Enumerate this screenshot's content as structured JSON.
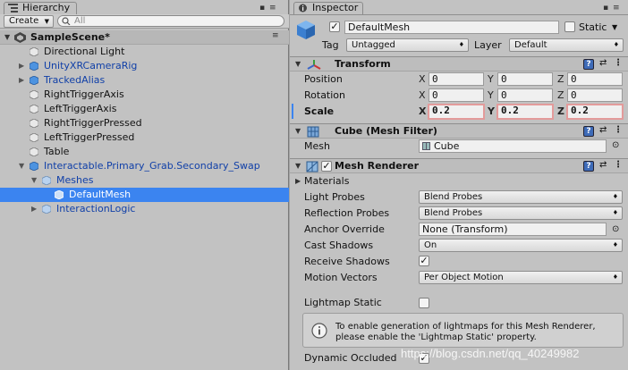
{
  "hierarchy": {
    "tab_label": "Hierarchy",
    "create_label": "Create",
    "search_placeholder": "All",
    "scene_name": "SampleScene*",
    "items": [
      {
        "label": "Directional Light"
      },
      {
        "label": "UnityXRCameraRig"
      },
      {
        "label": "TrackedAlias"
      },
      {
        "label": "RightTriggerAxis"
      },
      {
        "label": "LeftTriggerAxis"
      },
      {
        "label": "RightTriggerPressed"
      },
      {
        "label": "LeftTriggerPressed"
      },
      {
        "label": "Table"
      },
      {
        "label": "Interactable.Primary_Grab.Secondary_Swap"
      },
      {
        "label": "Meshes"
      },
      {
        "label": "DefaultMesh"
      },
      {
        "label": "InteractionLogic"
      }
    ]
  },
  "inspector": {
    "tab_label": "Inspector",
    "object_name": "DefaultMesh",
    "static_label": "Static",
    "tag_label": "Tag",
    "tag_value": "Untagged",
    "layer_label": "Layer",
    "layer_value": "Default",
    "transform": {
      "title": "Transform",
      "position_label": "Position",
      "rotation_label": "Rotation",
      "scale_label": "Scale",
      "axes": [
        "X",
        "Y",
        "Z"
      ],
      "position": [
        "0",
        "0",
        "0"
      ],
      "rotation": [
        "0",
        "0",
        "0"
      ],
      "scale": [
        "0.2",
        "0.2",
        "0.2"
      ]
    },
    "mesh_filter": {
      "title": "Cube (Mesh Filter)",
      "mesh_label": "Mesh",
      "mesh_value": "Cube"
    },
    "mesh_renderer": {
      "title": "Mesh Renderer",
      "materials_label": "Materials",
      "light_probes_label": "Light Probes",
      "light_probes_value": "Blend Probes",
      "reflection_probes_label": "Reflection Probes",
      "reflection_probes_value": "Blend Probes",
      "anchor_override_label": "Anchor Override",
      "anchor_override_value": "None (Transform)",
      "cast_shadows_label": "Cast Shadows",
      "cast_shadows_value": "On",
      "receive_shadows_label": "Receive Shadows",
      "motion_vectors_label": "Motion Vectors",
      "motion_vectors_value": "Per Object Motion",
      "lightmap_static_label": "Lightmap Static",
      "info_line1": "To enable generation of lightmaps for this Mesh Renderer,",
      "info_line2": "please enable the 'Lightmap Static' property.",
      "dynamic_occluded_label": "Dynamic Occluded"
    }
  },
  "watermark": "https://blog.csdn.net/qq_40249982",
  "colors": {
    "selection": "#3b84f0",
    "prefab_text": "#1140a8",
    "panel": "#c2c2c2",
    "highlight_border": "#e39b9b"
  }
}
